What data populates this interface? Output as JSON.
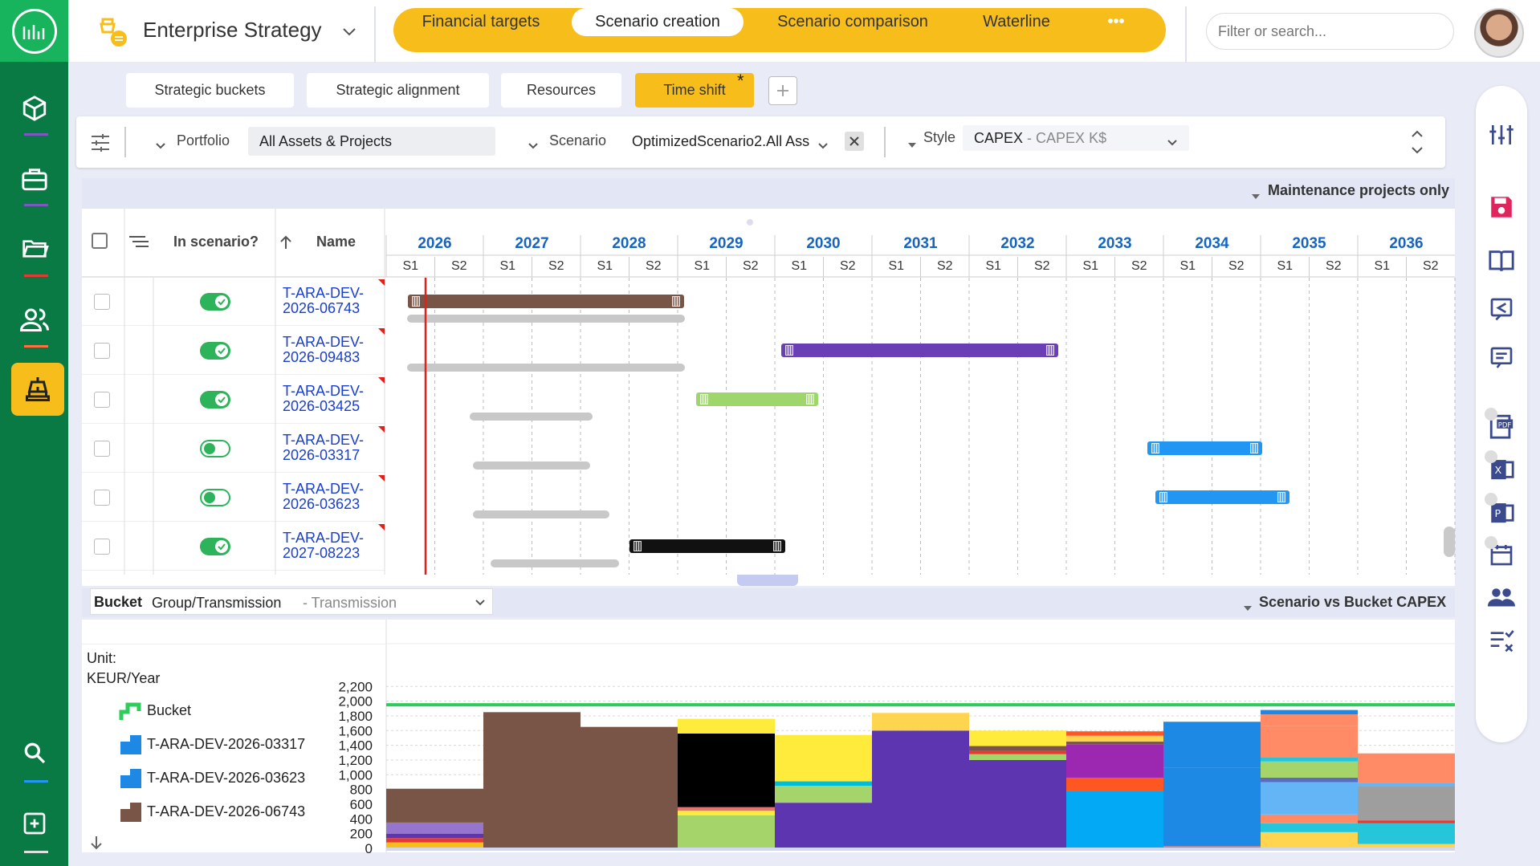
{
  "app": {
    "title": "Enterprise Strategy"
  },
  "nav": {
    "tabs": [
      "Financial targets",
      "Scenario creation",
      "Scenario comparison",
      "Waterline"
    ],
    "active": 1,
    "more": "•••"
  },
  "search": {
    "placeholder": "Filter or search..."
  },
  "subtabs": {
    "items": [
      "Strategic buckets",
      "Strategic alignment",
      "Resources",
      "Time shift"
    ],
    "active_marker": "*"
  },
  "filters": {
    "portfolio_label": "Portfolio",
    "portfolio_value": "All Assets & Projects",
    "scenario_label": "Scenario",
    "scenario_value": "OptimizedScenario2.All Ass",
    "style_label": "Style",
    "style_value": "CAPEX",
    "style_hint": "- CAPEX K$"
  },
  "gantt": {
    "filter_label": "Maintenance projects only",
    "col_in_scenario": "In scenario?",
    "col_name": "Name",
    "years": [
      "2026",
      "2027",
      "2028",
      "2029",
      "2030",
      "2031",
      "2032",
      "2033",
      "2034",
      "2035",
      "2036"
    ],
    "sem1": "S1",
    "sem2": "S2",
    "rows": [
      {
        "name_line1": "T-ARA-DEV-",
        "name_line2": "2026-06743",
        "in_scenario": true
      },
      {
        "name_line1": "T-ARA-DEV-",
        "name_line2": "2026-09483",
        "in_scenario": true
      },
      {
        "name_line1": "T-ARA-DEV-",
        "name_line2": "2026-03425",
        "in_scenario": true
      },
      {
        "name_line1": "T-ARA-DEV-",
        "name_line2": "2026-03317",
        "in_scenario": false
      },
      {
        "name_line1": "T-ARA-DEV-",
        "name_line2": "2026-03623",
        "in_scenario": false
      },
      {
        "name_line1": "T-ARA-DEV-",
        "name_line2": "2027-08223",
        "in_scenario": true
      }
    ]
  },
  "bucket": {
    "label": "Bucket",
    "value": "Group/Transmission",
    "hint": "- Transmission",
    "chart_title": "Scenario vs Bucket CAPEX"
  },
  "legend": {
    "unit_line1": "Unit:",
    "unit_line2": "KEUR/Year",
    "items": [
      "Bucket",
      "T-ARA-DEV-2026-03317",
      "T-ARA-DEV-2026-03623",
      "T-ARA-DEV-2026-06743"
    ]
  },
  "colors": {
    "accent": "#f7bd1b",
    "sidebar": "#0a7a45",
    "logo": "#18b35d",
    "bucket_line": "#2ecc5a",
    "link": "#1a3fd0",
    "today_line": "#e0201b"
  },
  "chart_data": {
    "type": "bar",
    "stacked": true,
    "categories": [
      "2026",
      "2027",
      "2028",
      "2029",
      "2030",
      "2031",
      "2032",
      "2033",
      "2034",
      "2035",
      "2036"
    ],
    "ylim": [
      0,
      2200
    ],
    "yticks": [
      0,
      200,
      400,
      600,
      800,
      1000,
      1200,
      1400,
      1600,
      1800,
      2000,
      2200
    ],
    "bucket_line": 1950,
    "stacks": [
      [
        {
          "v": 80,
          "c": "#f7bd1b"
        },
        {
          "v": 60,
          "c": "#e53935"
        },
        {
          "v": 60,
          "c": "#5e35b1"
        },
        {
          "v": 150,
          "c": "#9575cd"
        },
        {
          "v": 460,
          "c": "#795548"
        }
      ],
      [
        {
          "v": 1850,
          "c": "#795548"
        }
      ],
      [
        {
          "v": 1650,
          "c": "#795548"
        }
      ],
      [
        {
          "v": 450,
          "c": "#a5d46a"
        },
        {
          "v": 60,
          "c": "#ffeb3b"
        },
        {
          "v": 50,
          "c": "#e57373"
        },
        {
          "v": 1000,
          "c": "#000000"
        },
        {
          "v": 200,
          "c": "#ffeb3b"
        }
      ],
      [
        {
          "v": 620,
          "c": "#5e35b1"
        },
        {
          "v": 230,
          "c": "#a5d46a"
        },
        {
          "v": 60,
          "c": "#00bcd4"
        },
        {
          "v": 630,
          "c": "#ffeb3b"
        }
      ],
      [
        {
          "v": 1600,
          "c": "#5e35b1"
        },
        {
          "v": 240,
          "c": "#ffd54f"
        }
      ],
      [
        {
          "v": 1200,
          "c": "#5e35b1"
        },
        {
          "v": 80,
          "c": "#a5d46a"
        },
        {
          "v": 50,
          "c": "#e53935"
        },
        {
          "v": 60,
          "c": "#795548"
        },
        {
          "v": 210,
          "c": "#ffeb3b"
        }
      ],
      [
        {
          "v": 780,
          "c": "#03a9f4"
        },
        {
          "v": 180,
          "c": "#ff5722"
        },
        {
          "v": 450,
          "c": "#9c27b0"
        },
        {
          "v": 40,
          "c": "#795548"
        },
        {
          "v": 80,
          "c": "#ffd54f"
        },
        {
          "v": 60,
          "c": "#ff5722"
        }
      ],
      [
        {
          "v": 30,
          "c": "#e57373"
        },
        {
          "v": 1070,
          "c": "#1e88e5"
        },
        {
          "v": 620,
          "c": "#1e88e5"
        }
      ],
      [
        {
          "v": 220,
          "c": "#ffd54f"
        },
        {
          "v": 120,
          "c": "#26c6da"
        },
        {
          "v": 120,
          "c": "#ff8a65"
        },
        {
          "v": 440,
          "c": "#64b5f6"
        },
        {
          "v": 60,
          "c": "#5c6bc0"
        },
        {
          "v": 220,
          "c": "#a5d46a"
        },
        {
          "v": 60,
          "c": "#26c6da"
        },
        {
          "v": 420,
          "c": "#ff8a65"
        },
        {
          "v": 160,
          "c": "#ff8a65"
        },
        {
          "v": 60,
          "c": "#1e88e5"
        }
      ],
      [
        {
          "v": 60,
          "c": "#ffd54f"
        },
        {
          "v": 280,
          "c": "#26c6da"
        },
        {
          "v": 40,
          "c": "#e53935"
        },
        {
          "v": 460,
          "c": "#9e9e9e"
        },
        {
          "v": 50,
          "c": "#64b5f6"
        },
        {
          "v": 400,
          "c": "#ff8a65"
        }
      ]
    ]
  }
}
